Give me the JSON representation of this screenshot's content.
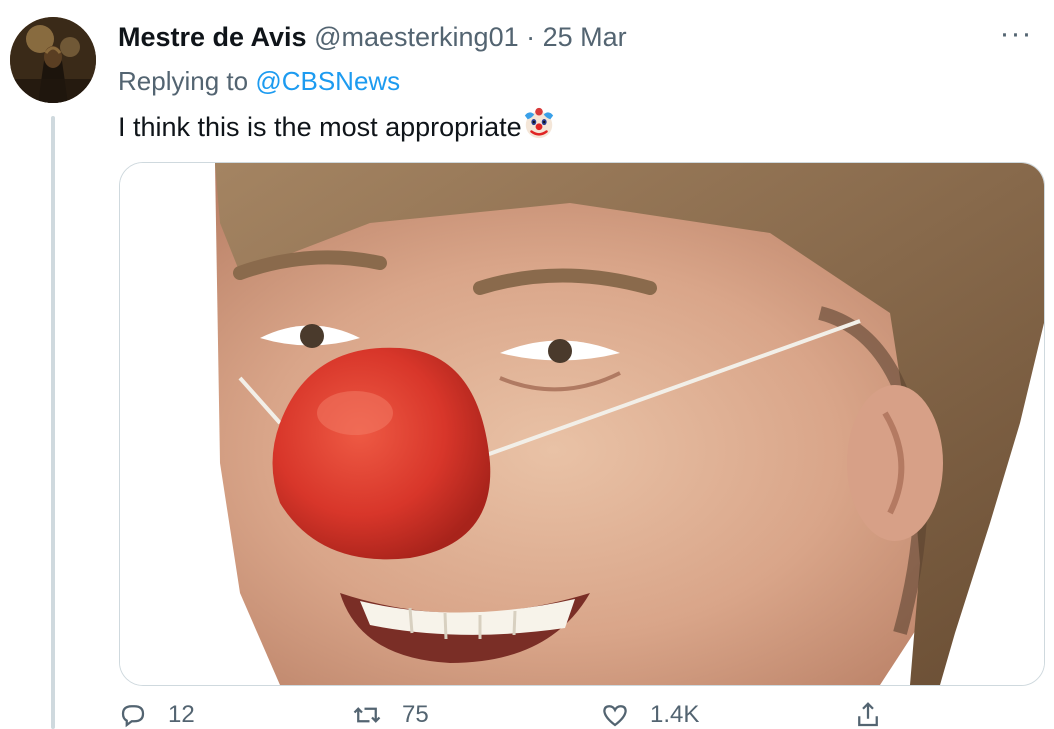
{
  "tweet": {
    "display_name": "Mestre de Avis",
    "handle": "@maesterking01",
    "separator": "·",
    "date": "25 Mar",
    "more_label": "···",
    "reply_prefix": "Replying to",
    "reply_to": "@CBSNews",
    "text": "I think this is the most appropriate",
    "emoji": "clown-face-icon",
    "media": {
      "description_icon": "clown-nose-photo",
      "nose_color": "#d8362a"
    },
    "actions": {
      "replies": "12",
      "retweets": "75",
      "likes": "1.4K"
    }
  },
  "colors": {
    "primary_text": "#0f1419",
    "secondary_text": "#536471",
    "link": "#1d9bf0",
    "border": "#cfd9de"
  }
}
